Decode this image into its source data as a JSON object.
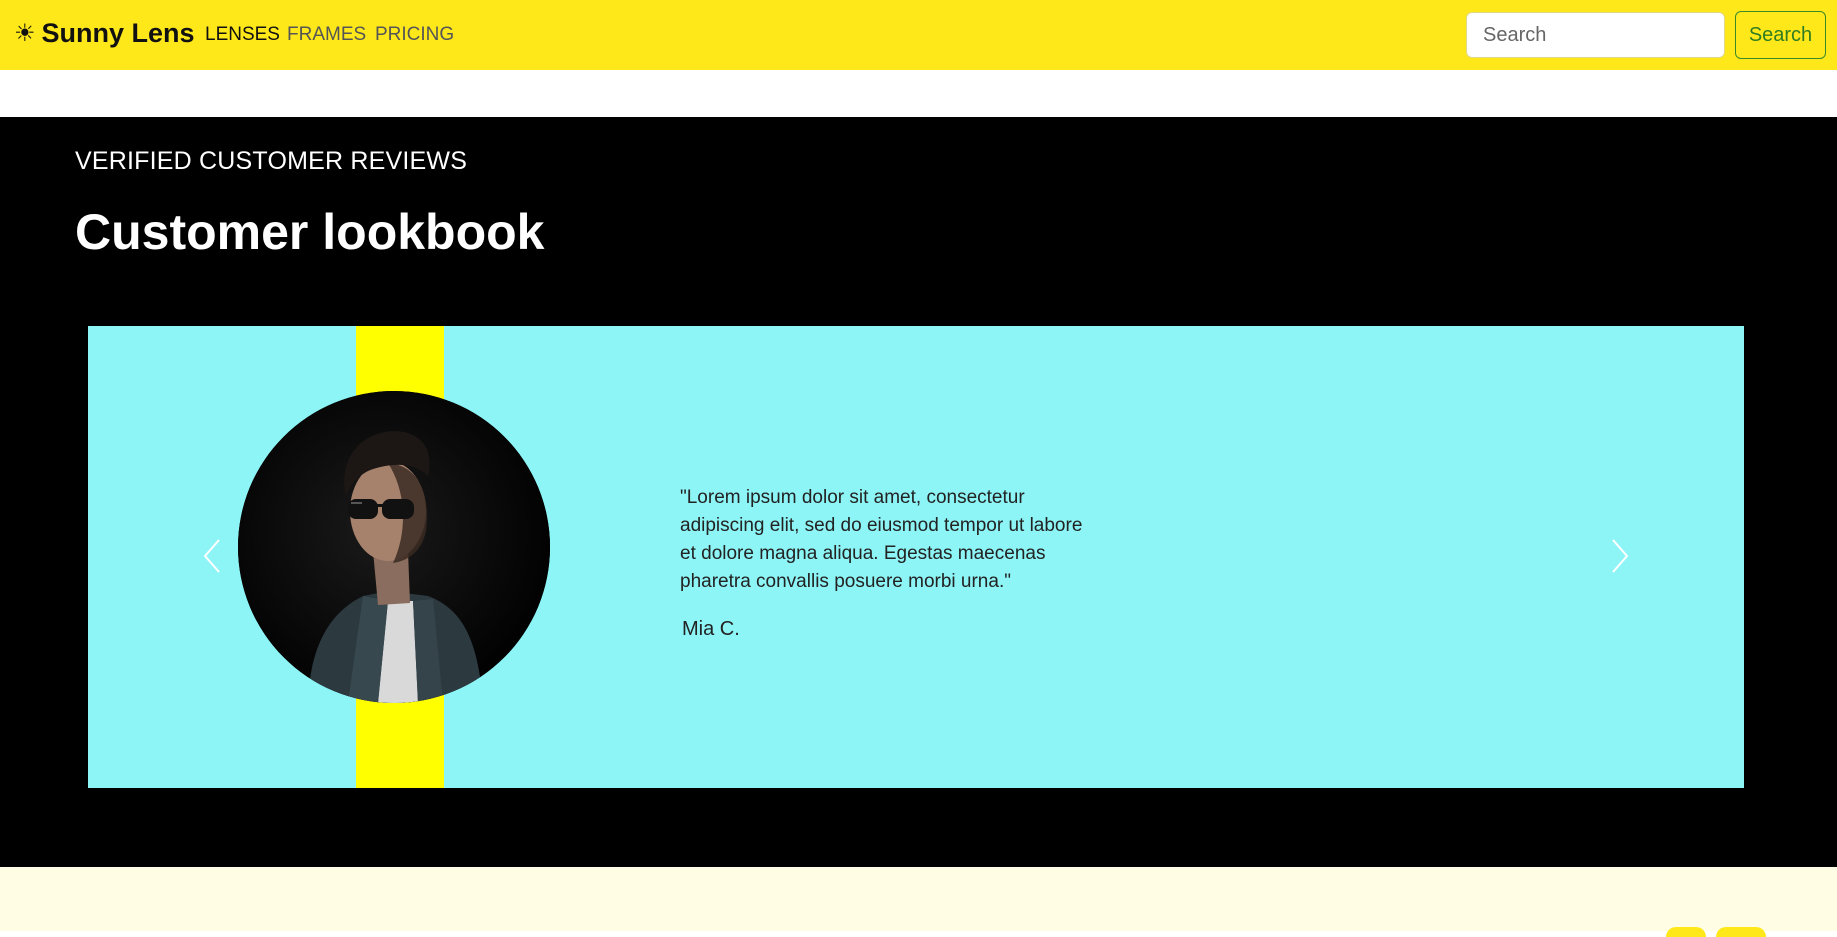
{
  "navbar": {
    "brand_icon": "☀",
    "brand_name": "Sunny Lens",
    "links": [
      {
        "label": "LENSES",
        "active": true
      },
      {
        "label": "FRAMES",
        "active": false
      },
      {
        "label": "PRICING",
        "active": false
      }
    ],
    "search": {
      "placeholder": "Search",
      "button_label": "Search"
    }
  },
  "reviews": {
    "eyebrow": "VERIFIED CUSTOMER REVIEWS",
    "title": "Customer lookbook",
    "testimonial": {
      "quote": "\"Lorem ipsum dolor sit amet, consectetur adipiscing elit, sed do eiusmod tempor ut labore et dolore magna aliqua. Egestas maecenas pharetra convallis posuere morbi urna.\"",
      "author": "Mia C."
    },
    "prev_icon": "chevron-left-icon",
    "next_icon": "chevron-right-icon"
  },
  "colors": {
    "navbar_bg": "#ffe81a",
    "section_bg": "#000000",
    "carousel_bg": "#8ef5f7",
    "accent_stripe": "#ffff00",
    "bottom_bg": "#fffde3",
    "search_button": "#2f7d20"
  }
}
